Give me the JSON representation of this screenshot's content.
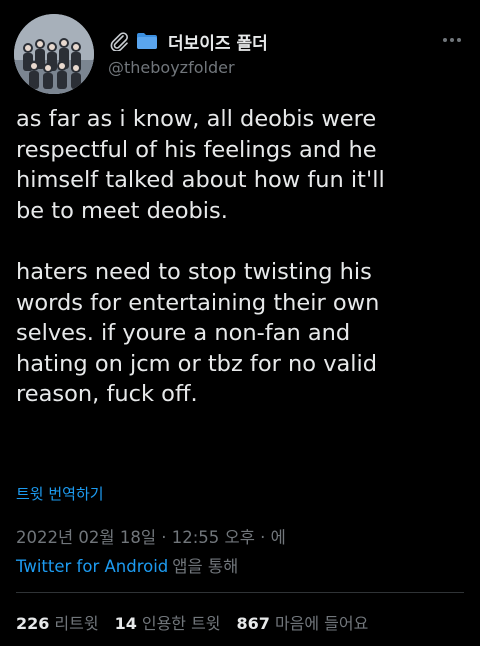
{
  "profile": {
    "display_name": "더보이즈 폴더",
    "handle": "@theboyzfolder",
    "name_icons": [
      "paperclip-icon",
      "folder-icon"
    ],
    "folder_color": "#3b8fe0"
  },
  "tweet": {
    "lines_paragraph1": [
      "as far as i know, all deobis were",
      "respectful of his feelings and he",
      "himself talked about how fun it'll",
      "be to meet deobis."
    ],
    "lines_paragraph2": [
      "haters need to stop twisting his",
      "words for entertaining their own",
      "selves. if youre a non-fan and",
      "hating on jcm or tbz for no valid",
      "reason, fuck off."
    ],
    "translate_label": "트윗 번역하기"
  },
  "meta": {
    "timestamp": "2022년 02월 18일 · 12:55 오후 · 에",
    "source_link": "Twitter for Android",
    "source_suffix": "앱을 통해"
  },
  "stats": {
    "retweets_count": "226",
    "retweets_label": "리트윗",
    "quotes_count": "14",
    "quotes_label": "인용한 트윗",
    "likes_count": "867",
    "likes_label": "마음에 들어요"
  },
  "colors": {
    "background": "#000000",
    "text_primary": "#e7e9ea",
    "text_secondary": "#71767b",
    "link": "#1d9bf0",
    "divider": "#2f3336"
  }
}
